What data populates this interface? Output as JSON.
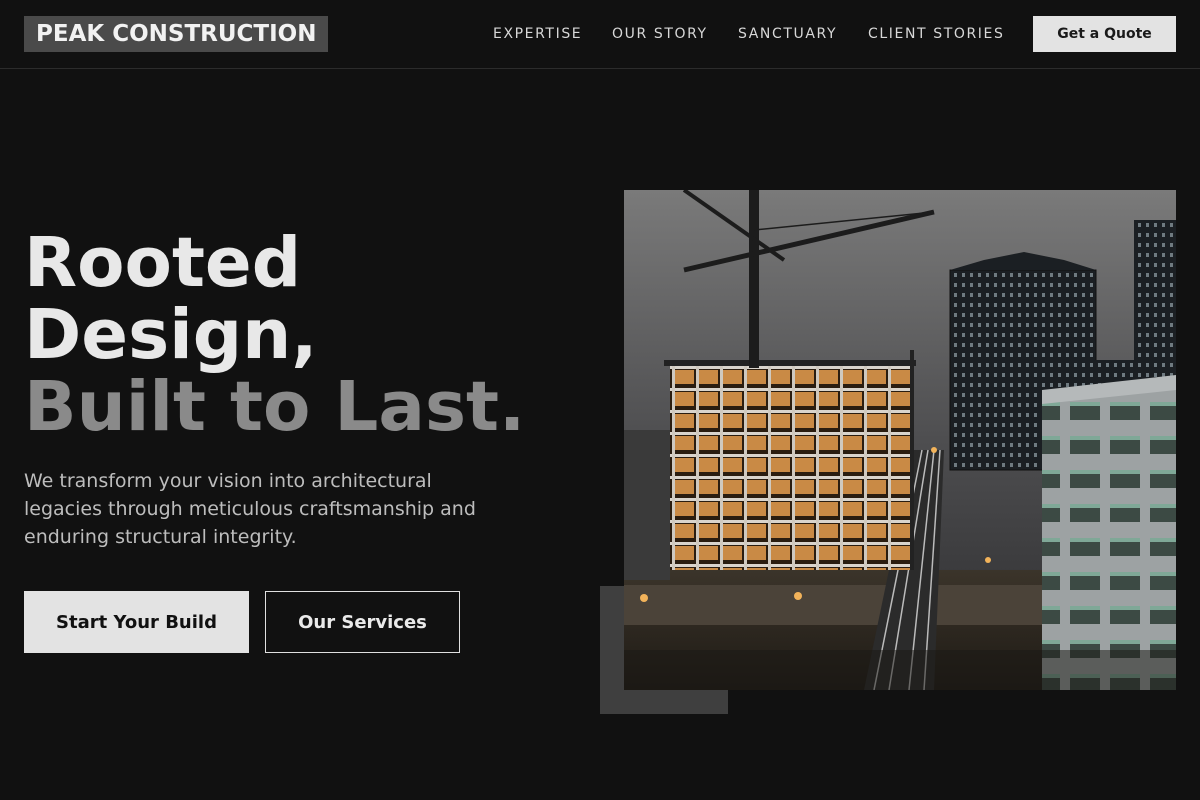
{
  "brand": {
    "logo_text": "PEAK CONSTRUCTION"
  },
  "nav": {
    "links": [
      "EXPERTISE",
      "OUR STORY",
      "SANCTUARY",
      "CLIENT STORIES"
    ],
    "cta_label": "Get a Quote"
  },
  "hero": {
    "title_line1": "Rooted",
    "title_line2": "Design,",
    "title_line3": "Built to Last.",
    "subtitle": "We transform your vision into architectural legacies through meticulous craftsmanship and enduring structural integrity.",
    "primary_label": "Start Your Build",
    "secondary_label": "Our Services"
  },
  "image": {
    "alt": "Construction site at night with tower crane and high-rise buildings",
    "icon": "construction-photo"
  },
  "colors": {
    "background": "#111111",
    "logo_bg": "#4a4a4a",
    "button_light": "#e3e3e3",
    "accent_block": "#3f3f3f",
    "muted_text": "#8a8a8a"
  }
}
